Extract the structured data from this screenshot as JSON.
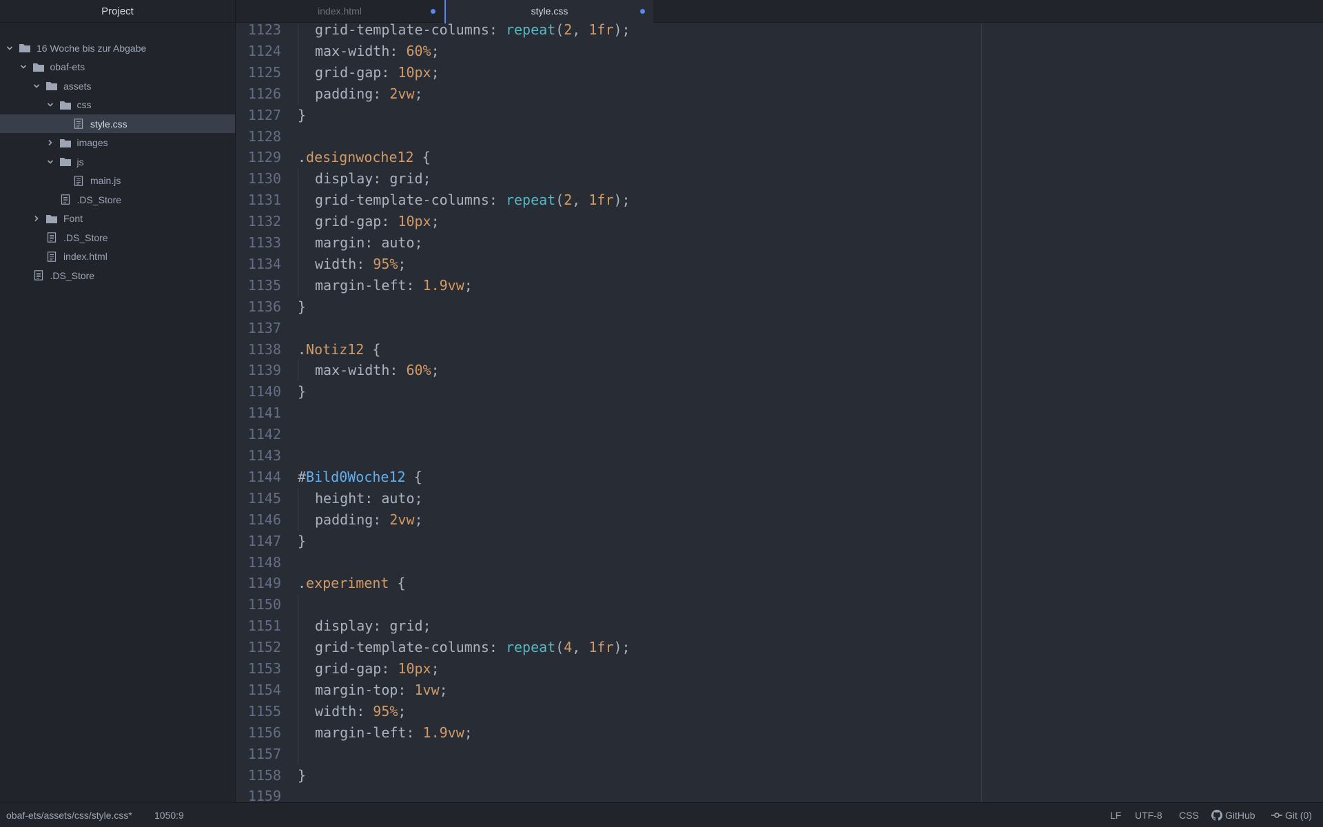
{
  "sidebar": {
    "title": "Project",
    "tree": [
      {
        "label": "16 Woche bis zur Abgabe",
        "type": "folder",
        "expanded": true,
        "depth": 0
      },
      {
        "label": "obaf-ets",
        "type": "folder",
        "expanded": true,
        "depth": 1
      },
      {
        "label": "assets",
        "type": "folder",
        "expanded": true,
        "depth": 2
      },
      {
        "label": "css",
        "type": "folder",
        "expanded": true,
        "depth": 3
      },
      {
        "label": "style.css",
        "type": "file",
        "depth": 4,
        "selected": true
      },
      {
        "label": "images",
        "type": "folder",
        "expanded": false,
        "depth": 3
      },
      {
        "label": "js",
        "type": "folder",
        "expanded": true,
        "depth": 3
      },
      {
        "label": "main.js",
        "type": "file",
        "depth": 4
      },
      {
        "label": ".DS_Store",
        "type": "file",
        "depth": 3
      },
      {
        "label": "Font",
        "type": "folder",
        "expanded": false,
        "depth": 2
      },
      {
        "label": ".DS_Store",
        "type": "file",
        "depth": 2
      },
      {
        "label": "index.html",
        "type": "file",
        "depth": 2
      },
      {
        "label": ".DS_Store",
        "type": "file",
        "depth": 1
      }
    ]
  },
  "tabs": [
    {
      "label": "index.html",
      "modified": true,
      "active": false
    },
    {
      "label": "style.css",
      "modified": true,
      "active": true
    }
  ],
  "editor": {
    "lines": [
      {
        "n": "1123",
        "indent": true,
        "tokens": [
          [
            "p",
            "grid-template-columns: "
          ],
          [
            "fn",
            "repeat"
          ],
          [
            "p",
            "("
          ],
          [
            "num",
            "2"
          ],
          [
            "p",
            ", "
          ],
          [
            "num",
            "1fr"
          ],
          [
            "p",
            ");"
          ]
        ]
      },
      {
        "n": "1124",
        "indent": true,
        "tokens": [
          [
            "p",
            "max-width: "
          ],
          [
            "num",
            "60%"
          ],
          [
            "p",
            ";"
          ]
        ]
      },
      {
        "n": "1125",
        "indent": true,
        "tokens": [
          [
            "p",
            "grid-gap: "
          ],
          [
            "num",
            "10px"
          ],
          [
            "p",
            ";"
          ]
        ]
      },
      {
        "n": "1126",
        "indent": true,
        "tokens": [
          [
            "p",
            "padding: "
          ],
          [
            "num",
            "2vw"
          ],
          [
            "p",
            ";"
          ]
        ]
      },
      {
        "n": "1127",
        "indent": false,
        "tokens": [
          [
            "p",
            "}"
          ]
        ]
      },
      {
        "n": "1128",
        "indent": false,
        "tokens": []
      },
      {
        "n": "1129",
        "indent": false,
        "tokens": [
          [
            "p",
            "."
          ],
          [
            "sel",
            "designwoche12"
          ],
          [
            "p",
            " {"
          ]
        ]
      },
      {
        "n": "1130",
        "indent": true,
        "tokens": [
          [
            "p",
            "display: grid;"
          ]
        ]
      },
      {
        "n": "1131",
        "indent": true,
        "tokens": [
          [
            "p",
            "grid-template-columns: "
          ],
          [
            "fn",
            "repeat"
          ],
          [
            "p",
            "("
          ],
          [
            "num",
            "2"
          ],
          [
            "p",
            ", "
          ],
          [
            "num",
            "1fr"
          ],
          [
            "p",
            ");"
          ]
        ]
      },
      {
        "n": "1132",
        "indent": true,
        "tokens": [
          [
            "p",
            "grid-gap: "
          ],
          [
            "num",
            "10px"
          ],
          [
            "p",
            ";"
          ]
        ]
      },
      {
        "n": "1133",
        "indent": true,
        "tokens": [
          [
            "p",
            "margin: auto;"
          ]
        ]
      },
      {
        "n": "1134",
        "indent": true,
        "tokens": [
          [
            "p",
            "width: "
          ],
          [
            "num",
            "95%"
          ],
          [
            "p",
            ";"
          ]
        ]
      },
      {
        "n": "1135",
        "indent": true,
        "tokens": [
          [
            "p",
            "margin-left: "
          ],
          [
            "num",
            "1.9vw"
          ],
          [
            "p",
            ";"
          ]
        ]
      },
      {
        "n": "1136",
        "indent": false,
        "tokens": [
          [
            "p",
            "}"
          ]
        ]
      },
      {
        "n": "1137",
        "indent": false,
        "tokens": []
      },
      {
        "n": "1138",
        "indent": false,
        "tokens": [
          [
            "p",
            "."
          ],
          [
            "sel",
            "Notiz12"
          ],
          [
            "p",
            " {"
          ]
        ]
      },
      {
        "n": "1139",
        "indent": true,
        "tokens": [
          [
            "p",
            "max-width: "
          ],
          [
            "num",
            "60%"
          ],
          [
            "p",
            ";"
          ]
        ]
      },
      {
        "n": "1140",
        "indent": false,
        "tokens": [
          [
            "p",
            "}"
          ]
        ]
      },
      {
        "n": "1141",
        "indent": false,
        "tokens": []
      },
      {
        "n": "1142",
        "indent": false,
        "tokens": []
      },
      {
        "n": "1143",
        "indent": false,
        "tokens": []
      },
      {
        "n": "1144",
        "indent": false,
        "tokens": [
          [
            "p",
            "#"
          ],
          [
            "id",
            "Bild0Woche12"
          ],
          [
            "p",
            " {"
          ]
        ]
      },
      {
        "n": "1145",
        "indent": true,
        "tokens": [
          [
            "p",
            "height: auto;"
          ]
        ]
      },
      {
        "n": "1146",
        "indent": true,
        "tokens": [
          [
            "p",
            "padding: "
          ],
          [
            "num",
            "2vw"
          ],
          [
            "p",
            ";"
          ]
        ]
      },
      {
        "n": "1147",
        "indent": false,
        "tokens": [
          [
            "p",
            "}"
          ]
        ]
      },
      {
        "n": "1148",
        "indent": false,
        "tokens": []
      },
      {
        "n": "1149",
        "indent": false,
        "tokens": [
          [
            "p",
            "."
          ],
          [
            "sel",
            "experiment"
          ],
          [
            "p",
            " {"
          ]
        ]
      },
      {
        "n": "1150",
        "indent": true,
        "tokens": []
      },
      {
        "n": "1151",
        "indent": true,
        "tokens": [
          [
            "p",
            "display: grid;"
          ]
        ]
      },
      {
        "n": "1152",
        "indent": true,
        "tokens": [
          [
            "p",
            "grid-template-columns: "
          ],
          [
            "fn",
            "repeat"
          ],
          [
            "p",
            "("
          ],
          [
            "num",
            "4"
          ],
          [
            "p",
            ", "
          ],
          [
            "num",
            "1fr"
          ],
          [
            "p",
            ");"
          ]
        ]
      },
      {
        "n": "1153",
        "indent": true,
        "tokens": [
          [
            "p",
            "grid-gap: "
          ],
          [
            "num",
            "10px"
          ],
          [
            "p",
            ";"
          ]
        ]
      },
      {
        "n": "1154",
        "indent": true,
        "tokens": [
          [
            "p",
            "margin-top: "
          ],
          [
            "num",
            "1vw"
          ],
          [
            "p",
            ";"
          ]
        ]
      },
      {
        "n": "1155",
        "indent": true,
        "tokens": [
          [
            "p",
            "width: "
          ],
          [
            "num",
            "95%"
          ],
          [
            "p",
            ";"
          ]
        ]
      },
      {
        "n": "1156",
        "indent": true,
        "tokens": [
          [
            "p",
            "margin-left: "
          ],
          [
            "num",
            "1.9vw"
          ],
          [
            "p",
            ";"
          ]
        ]
      },
      {
        "n": "1157",
        "indent": true,
        "tokens": []
      },
      {
        "n": "1158",
        "indent": false,
        "tokens": [
          [
            "p",
            "}"
          ]
        ]
      },
      {
        "n": "1159",
        "indent": false,
        "tokens": []
      }
    ]
  },
  "statusbar": {
    "file_path": "obaf-ets/assets/css/style.css*",
    "cursor": "1050:9",
    "line_ending": "LF",
    "encoding": "UTF-8",
    "grammar": "CSS",
    "github": "GitHub",
    "git": "Git (0)"
  },
  "colors": {
    "accent": "#568af2",
    "selector": "#d19a66",
    "id_selector": "#61afef",
    "function": "#56b6c2",
    "number": "#d19a66"
  }
}
